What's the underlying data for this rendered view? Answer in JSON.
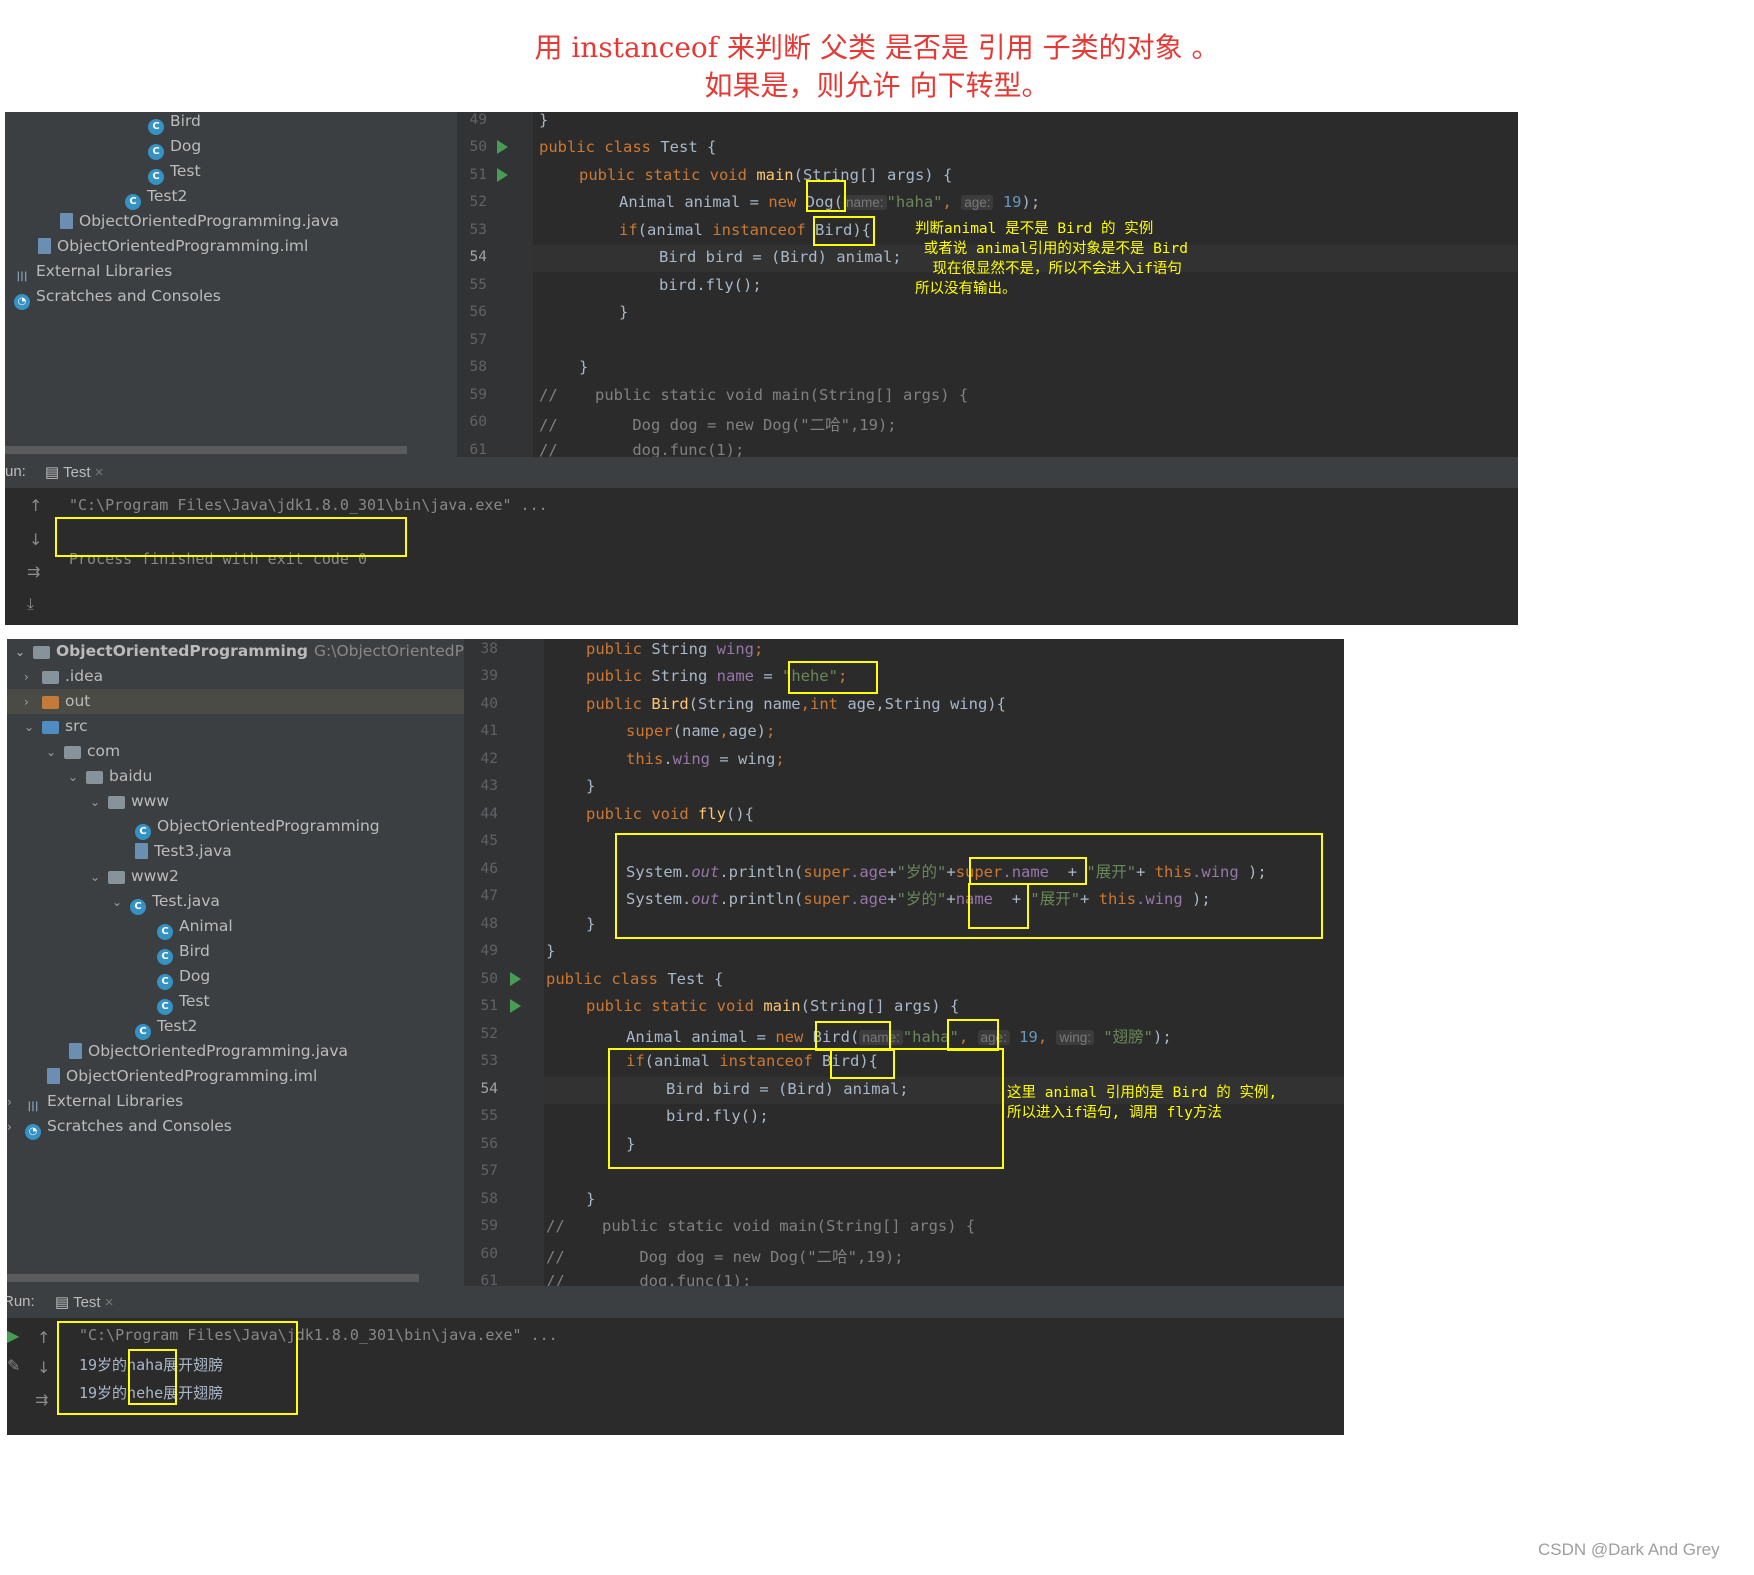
{
  "caption": {
    "line1": "用 instanceof 来判断 父类 是否是 引用 子类的对象 。",
    "line2": "如果是，则允许 向下转型。"
  },
  "top": {
    "tree": [
      {
        "label": "Bird",
        "icon": "class-icon"
      },
      {
        "label": "Dog",
        "icon": "class-icon"
      },
      {
        "label": "Test",
        "icon": "class-run-icon"
      },
      {
        "label": "Test2",
        "icon": "class-icon"
      },
      {
        "label": "ObjectOrientedProgramming.java",
        "icon": "java-file-icon"
      },
      {
        "label": "ObjectOrientedProgramming.iml",
        "icon": "iml-file-icon"
      },
      {
        "label": "External Libraries",
        "icon": "library-icon"
      },
      {
        "label": "Scratches and Consoles",
        "icon": "scratches-icon"
      }
    ],
    "line_numbers": [
      "49",
      "50",
      "51",
      "52",
      "53",
      "54",
      "55",
      "56",
      "57",
      "58",
      "59",
      "60",
      "61"
    ],
    "code": {
      "l49": "}",
      "l50_kw": "public class ",
      "l50_name": "Test {",
      "l51_kw": "public static void ",
      "l51_fn": "main",
      "l51_rest": "(String[] args) {",
      "l52_a": "Animal animal = ",
      "l52_new": "new ",
      "l52_cls": "Dog",
      "l52_paren": "(",
      "l52_hint1": "name:",
      "l52_str": "\"haha\"",
      "l52_comma": ", ",
      "l52_hint2": "age:",
      "l52_num": "19",
      "l52_end": ");",
      "l53_if": "if",
      "l53_a": "(animal ",
      "l53_inst": "instanceof",
      "l53_cls": " Bird",
      "l53_end": "){",
      "l54": "Bird bird = (Bird) animal;",
      "l55": "bird.fly();",
      "l56": "}",
      "l58": "}",
      "l59": "//    public static void main(String[] args) {",
      "l60": "//        Dog dog = new Dog(\"二哈\",19);",
      "l61": "//        dog.func(1);"
    },
    "note": "判断animal 是不是 Bird 的 实例\n 或者说 animal引用的对象是不是 Bird\n  现在很显然不是，所以不会进入if语句\n所以没有输出。",
    "run_label": "un:",
    "run_tab": "Test",
    "console": [
      "\"C:\\Program Files\\Java\\jdk1.8.0_301\\bin\\java.exe\" ...",
      "",
      "Process finished with exit code 0"
    ]
  },
  "bottom": {
    "tree": [
      {
        "label": "ObjectOrientedProgramming",
        "path": "G:\\ObjectOrientedProgram",
        "chev": "⌄",
        "icon": "project-folder-icon",
        "indent": 0,
        "bold": true
      },
      {
        "label": ".idea",
        "chev": "›",
        "icon": "folder-icon",
        "indent": 1
      },
      {
        "label": "out",
        "chev": "›",
        "icon": "folder-orange-icon",
        "indent": 1,
        "sel": true
      },
      {
        "label": "src",
        "chev": "⌄",
        "icon": "folder-blue-icon",
        "indent": 1
      },
      {
        "label": "com",
        "chev": "⌄",
        "icon": "package-icon",
        "indent": 2
      },
      {
        "label": "baidu",
        "chev": "⌄",
        "icon": "package-icon",
        "indent": 3
      },
      {
        "label": "www",
        "chev": "⌄",
        "icon": "package-icon",
        "indent": 4
      },
      {
        "label": "ObjectOrientedProgramming",
        "chev": "",
        "icon": "class-icon",
        "indent": 5
      },
      {
        "label": "Test3.java",
        "chev": "",
        "icon": "java-file-icon",
        "indent": 5
      },
      {
        "label": "www2",
        "chev": "⌄",
        "icon": "package-icon",
        "indent": 4
      },
      {
        "label": "Test.java",
        "chev": "⌄",
        "icon": "class-icon",
        "indent": 5
      },
      {
        "label": "Animal",
        "chev": "",
        "icon": "class-icon",
        "indent": 6
      },
      {
        "label": "Bird",
        "chev": "",
        "icon": "class-icon",
        "indent": 6
      },
      {
        "label": "Dog",
        "chev": "",
        "icon": "class-icon",
        "indent": 6
      },
      {
        "label": "Test",
        "chev": "",
        "icon": "class-run-icon",
        "indent": 6
      },
      {
        "label": "Test2",
        "chev": "",
        "icon": "class-icon",
        "indent": 5
      },
      {
        "label": "ObjectOrientedProgramming.java",
        "chev": "",
        "icon": "java-file-icon",
        "indent": 2
      },
      {
        "label": "ObjectOrientedProgramming.iml",
        "chev": "",
        "icon": "iml-file-icon",
        "indent": 1
      },
      {
        "label": "External Libraries",
        "chev": "›",
        "icon": "library-icon",
        "indent": 0
      },
      {
        "label": "Scratches and Consoles",
        "chev": "›",
        "icon": "scratches-icon",
        "indent": 0
      }
    ],
    "line_numbers": [
      "38",
      "39",
      "40",
      "41",
      "42",
      "43",
      "44",
      "45",
      "46",
      "47",
      "48",
      "49",
      "50",
      "51",
      "52",
      "53",
      "54",
      "55",
      "56",
      "57",
      "58",
      "59",
      "60",
      "61"
    ],
    "code": {
      "l38_kw": "public ",
      "l38_t": "String ",
      "l38_f": "wing",
      "l38_e": ";",
      "l39_kw": "public ",
      "l39_t": "String ",
      "l39_f": "name",
      "l39_eq": " = ",
      "l39_s": "\"hehe\"",
      "l39_e": ";",
      "l40_kw": "public ",
      "l40_fn": "Bird",
      "l40_r1": "(String name",
      "l40_c": ",",
      "l40_int": "int ",
      "l40_r2": "age",
      "l40_r3": ",String wing){",
      "l41_kw": "super",
      "l41_r": "(name",
      "l41_c": ",",
      "l41_r2": "age)",
      "l41_e": ";",
      "l42_kw": "this",
      "l42_d": ".",
      "l42_f": "wing",
      "l42_r": " = wing",
      "l42_e": ";",
      "l43": "}",
      "l44_kw": "public void ",
      "l44_fn": "fly",
      "l44_r": "(){",
      "l46_a": "System.",
      "l46_out": "out",
      "l46_b": ".println(",
      "l46_sup": "super",
      "l46_age": ".age",
      "l46_plus": "+",
      "l46_s1": "\"岁的\"",
      "l46_plus2": "+",
      "l46_sup2": "super",
      "l46_name": ".name ",
      "l46_p3": " + ",
      "l46_s2": "\"展开\"",
      "l46_p4": "+ ",
      "l46_this": "this",
      "l46_wing": ".wing",
      "l46_end": " );",
      "l47_a": "System.",
      "l47_out": "out",
      "l47_b": ".println(",
      "l47_sup": "super",
      "l47_age": ".age",
      "l47_plus": "+",
      "l47_s1": "\"岁的\"",
      "l47_plus2": "+",
      "l47_name": "name ",
      "l47_p3": " + ",
      "l47_s2": "\"展开\"",
      "l47_p4": "+ ",
      "l47_this": "this",
      "l47_wing": ".wing",
      "l47_end": " );",
      "l48": "}",
      "l49": "}",
      "l50_kw": "public class ",
      "l50_name": "Test {",
      "l51_kw": "public static void ",
      "l51_fn": "main",
      "l51_rest": "(String[] args) {",
      "l52_a": "Animal animal = ",
      "l52_new": "new ",
      "l52_cls": "Bird",
      "l52_paren": "(",
      "l52_hint1": "name:",
      "l52_str": "\"haha\"",
      "l52_comma": ", ",
      "l52_hint2": "age:",
      "l52_num": "19",
      "l52_comma2": ", ",
      "l52_hint3": "wing:",
      "l52_str2": "\"翅膀\"",
      "l52_end": ");",
      "l53_if": "if",
      "l53_a": "(animal ",
      "l53_inst": "instanceof",
      "l53_cls": " Bird",
      "l53_end": "){",
      "l54": "Bird bird = (Bird) animal;",
      "l55": "bird.fly();",
      "l56": "}",
      "l58": "}",
      "l59": "//    public static void main(String[] args) {",
      "l60": "//        Dog dog = new Dog(\"二哈\",19);",
      "l61": "//        dog.func(1);"
    },
    "note": "这里 animal 引用的是 Bird 的 实例,\n所以进入if语句, 调用 fly方法",
    "run_label": "Run:",
    "run_tab": "Test",
    "console": [
      "\"C:\\Program Files\\Java\\jdk1.8.0_301\\bin\\java.exe\" ...",
      "19岁的haha展开翅膀",
      "19岁的hehe展开翅膀"
    ]
  },
  "watermark": "CSDN @Dark And Grey",
  "colors": {
    "caption": "#e53935",
    "highlight_box": "#ffff00",
    "editor_bg": "#2b2b2b",
    "tree_bg": "#3c3f41"
  }
}
